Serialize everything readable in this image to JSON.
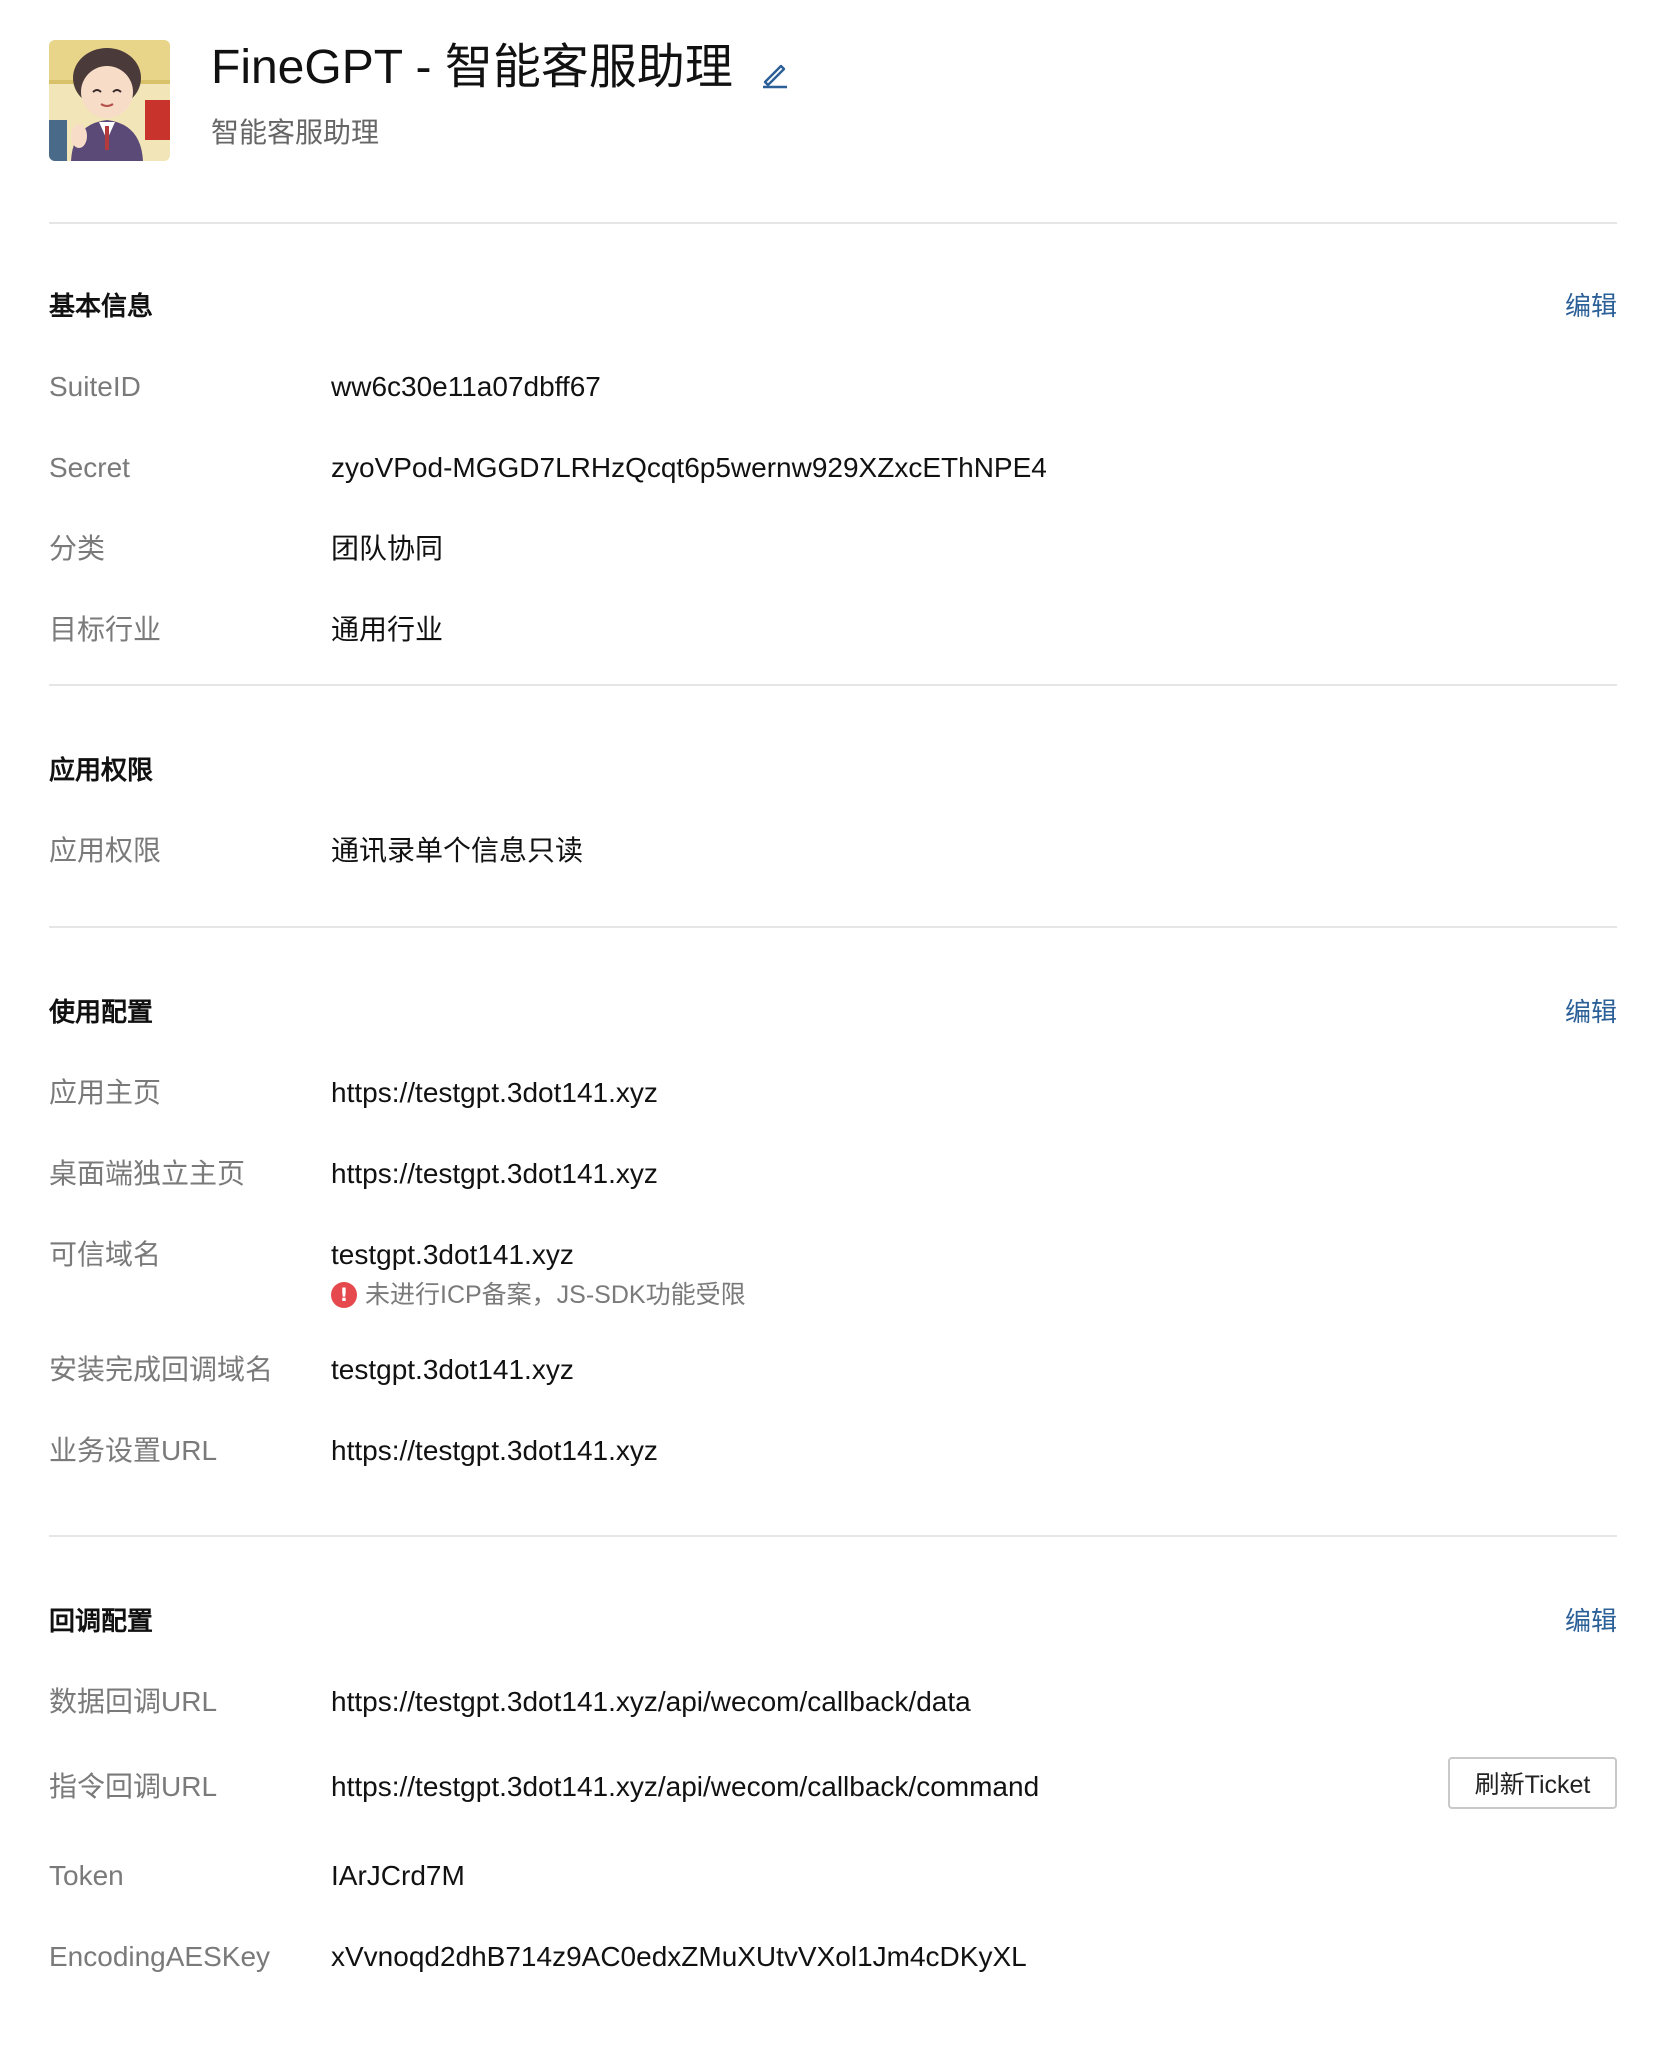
{
  "app": {
    "title": "FineGPT - 智能客服助理",
    "subtitle": "智能客服助理"
  },
  "sections": {
    "basic": {
      "title": "基本信息",
      "edit_label": "编辑",
      "rows": [
        {
          "label": "SuiteID",
          "value": "ww6c30e11a07dbff67"
        },
        {
          "label": "Secret",
          "value": "zyoVPod-MGGD7LRHzQcqt6p5wernw929XZxcEThNPE4"
        },
        {
          "label": "分类",
          "value": "团队协同"
        },
        {
          "label": "目标行业",
          "value": "通用行业"
        }
      ]
    },
    "permissions": {
      "title": "应用权限",
      "rows": [
        {
          "label": "应用权限",
          "value": "通讯录单个信息只读"
        }
      ]
    },
    "usage": {
      "title": "使用配置",
      "edit_label": "编辑",
      "rows": [
        {
          "label": "应用主页",
          "value": "https://testgpt.3dot141.xyz"
        },
        {
          "label": "桌面端独立主页",
          "value": "https://testgpt.3dot141.xyz"
        },
        {
          "label": "可信域名",
          "value": "testgpt.3dot141.xyz",
          "warning": "未进行ICP备案，JS-SDK功能受限"
        },
        {
          "label": "安装完成回调域名",
          "value": "testgpt.3dot141.xyz"
        },
        {
          "label": "业务设置URL",
          "value": "https://testgpt.3dot141.xyz"
        }
      ]
    },
    "callback": {
      "title": "回调配置",
      "edit_label": "编辑",
      "refresh_button": "刷新Ticket",
      "rows": [
        {
          "label": "数据回调URL",
          "value": "https://testgpt.3dot141.xyz/api/wecom/callback/data"
        },
        {
          "label": "指令回调URL",
          "value": "https://testgpt.3dot141.xyz/api/wecom/callback/command"
        },
        {
          "label": "Token",
          "value": "IArJCrd7M"
        },
        {
          "label": "EncodingAESKey",
          "value": "xVvnoqd2dhB714z9AC0edxZMuXUtvVXol1Jm4cDKyXL"
        }
      ]
    }
  },
  "icons": {
    "edit_title": "pencil-icon",
    "warning": "exclamation-circle-icon",
    "avatar": "cartoon-avatar"
  },
  "colors": {
    "link": "#2b5f97",
    "warning": "#e5484d"
  }
}
